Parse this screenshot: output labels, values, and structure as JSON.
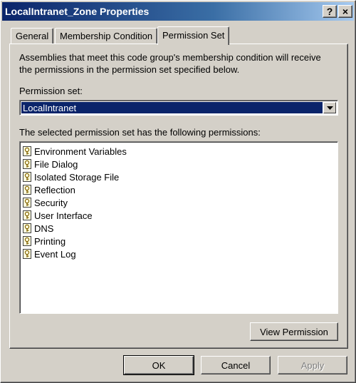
{
  "window": {
    "title": "LocalIntranet_Zone Properties",
    "help_glyph": "?",
    "close_glyph": "×"
  },
  "tabs": [
    {
      "label": "General"
    },
    {
      "label": "Membership Condition"
    },
    {
      "label": "Permission Set"
    }
  ],
  "panel": {
    "description": "Assemblies that meet this code group's membership condition will receive the permissions in the permission set specified below.",
    "permission_set_label": "Permission set:",
    "permission_set_value": "LocalIntranet",
    "permissions_label": "The selected permission set has the following permissions:",
    "permissions": [
      "Environment Variables",
      "File Dialog",
      "Isolated Storage File",
      "Reflection",
      "Security",
      "User Interface",
      "DNS",
      "Printing",
      "Event Log"
    ],
    "view_permission_label": "View Permission"
  },
  "footer": {
    "ok_label": "OK",
    "cancel_label": "Cancel",
    "apply_label": "Apply"
  }
}
